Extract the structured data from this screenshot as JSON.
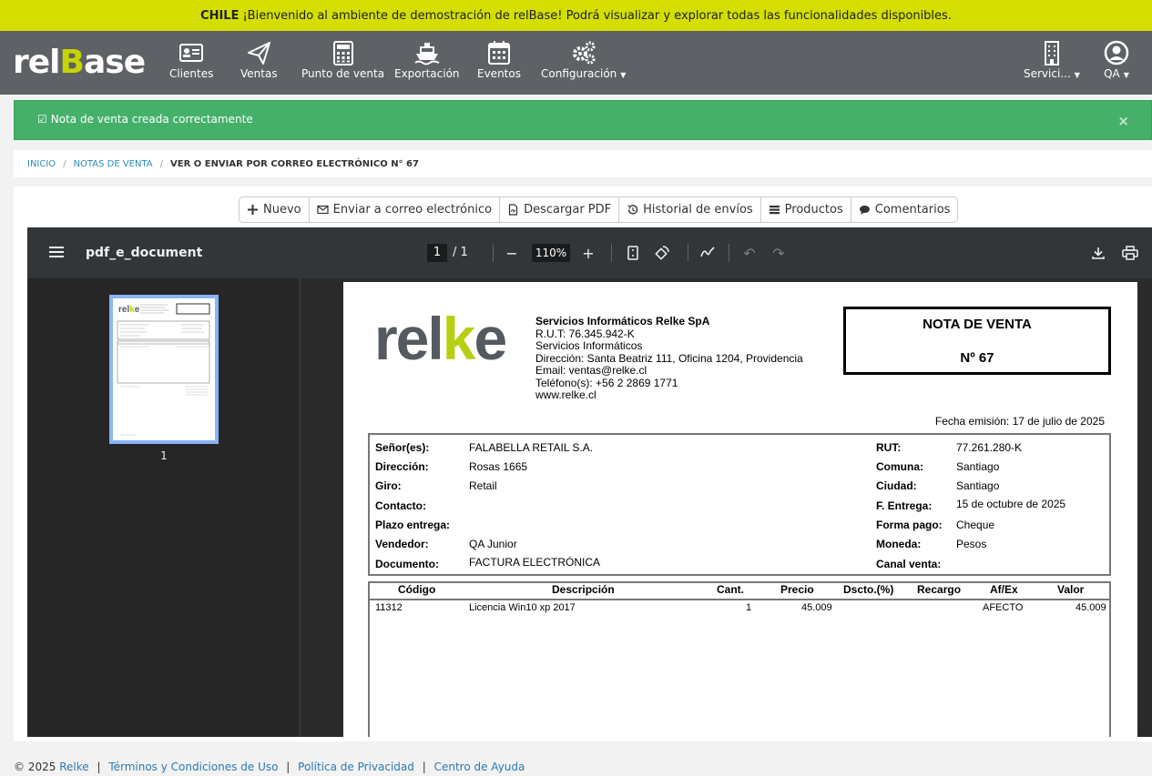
{
  "banner": {
    "country": "CHILE",
    "message": "¡Bienvenido al ambiente de demostración de relBase! Podrá visualizar y explorar todas las funcionalidades disponibles."
  },
  "logo": {
    "part1": "rel",
    "part2": "B",
    "part3": "ase"
  },
  "nav": {
    "clientes": "Clientes",
    "ventas": "Ventas",
    "pos": "Punto de venta",
    "exportacion": "Exportación",
    "eventos": "Eventos",
    "configuracion": "Configuración",
    "servicio": "Servici...",
    "user": "QA"
  },
  "alert": {
    "message": "Nota de venta creada correctamente",
    "close": "×"
  },
  "breadcrumb": {
    "home": "INICIO",
    "section": "NOTAS DE VENTA",
    "current": "VER O ENVIAR POR CORREO ELECTRÓNICO N° 67"
  },
  "actions": {
    "nuevo": "Nuevo",
    "enviar": "Enviar a correo electrónico",
    "descargar": "Descargar PDF",
    "historial": "Historial de envíos",
    "productos": "Productos",
    "comentarios": "Comentarios"
  },
  "viewer": {
    "title": "pdf_e_document",
    "page": "1",
    "page_of": "/  1",
    "zoom": "110%",
    "thumb_label": "1"
  },
  "document": {
    "logo_a": "rel",
    "logo_b": "k",
    "logo_c": "e",
    "company_name": "Servicios Informáticos Relke SpA",
    "rut": "R.U.T: 76.345.942-K",
    "business": "Servicios Informáticos",
    "address": "Dirección: Santa Beatriz 111, Oficina 1204, Providencia",
    "email": "Email: ventas@relke.cl",
    "phone": "Teléfono(s): +56 2 2869 1771",
    "web": "www.relke.cl",
    "doc_type": "NOTA DE VENTA",
    "doc_number": "Nº 67",
    "fecha": "Fecha emisión: 17 de julio de 2025",
    "info": {
      "senor_lbl": "Señor(es):",
      "senor": "FALABELLA RETAIL S.A.",
      "direccion_lbl": "Dirección:",
      "direccion": "Rosas 1665",
      "giro_lbl": "Giro:",
      "giro": "Retail",
      "contacto_lbl": "Contacto:",
      "plazo_lbl": "Plazo entrega:",
      "vendedor_lbl": "Vendedor:",
      "vendedor": "QA Junior",
      "documento_lbl": "Documento:",
      "documento": "FACTURA ELECTRÓNICA",
      "rut_lbl": "RUT:",
      "rut": "77.261.280-K",
      "comuna_lbl": "Comuna:",
      "comuna": "Santiago",
      "ciudad_lbl": "Ciudad:",
      "ciudad": "Santiago",
      "entrega_lbl": "F. Entrega:",
      "entrega": "15 de octubre de 2025",
      "forma_lbl": "Forma pago:",
      "forma": "Cheque",
      "moneda_lbl": "Moneda:",
      "moneda": "Pesos",
      "canal_lbl": "Canal venta:"
    },
    "columns": {
      "codigo": "Código",
      "descripcion": "Descripción",
      "cant": "Cant.",
      "precio": "Precio",
      "dscto": "Dscto.(%)",
      "recargo": "Recargo",
      "afex": "Af/Ex",
      "valor": "Valor"
    },
    "item": {
      "codigo": "11312",
      "descripcion": "Licencia Win10 xp 2017",
      "cant": "1",
      "precio": "45.009",
      "afex": "AFECTO",
      "valor": "45.009"
    }
  },
  "footer": {
    "copy": "© 2025",
    "relke": "Relke",
    "terms": "Términos y Condiciones de Uso",
    "privacy": "Política de Privacidad",
    "help": "Centro de Ayuda"
  }
}
